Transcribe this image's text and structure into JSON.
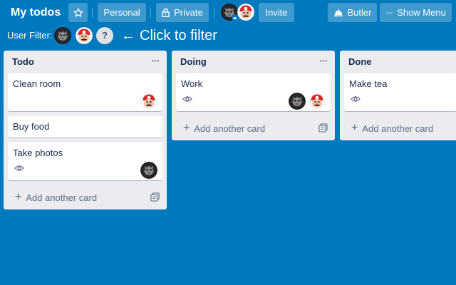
{
  "header": {
    "title": "My todos",
    "star_icon": "star-icon",
    "team_label": "Personal",
    "visibility_label": "Private",
    "visibility_icon": "lock-icon",
    "invite_label": "Invite",
    "butler_label": "Butler",
    "butler_icon": "butler-icon",
    "menu_label": "Show Menu",
    "menu_icon": "ellipsis-icon",
    "members": [
      "robot-avatar",
      "mario-avatar"
    ]
  },
  "filter": {
    "label": "User Filter:",
    "avatars": [
      "robot-avatar",
      "mario-avatar"
    ],
    "help_label": "?",
    "hint_arrow": "←",
    "hint_text": "Click to filter"
  },
  "lists": [
    {
      "title": "Todo",
      "menu_label": "···",
      "cards": [
        {
          "title": "Clean room",
          "watched": false,
          "members": [
            "mario-avatar"
          ]
        },
        {
          "title": "Buy food",
          "watched": false,
          "members": []
        },
        {
          "title": "Take photos",
          "watched": true,
          "members": [
            "robot-avatar"
          ]
        }
      ],
      "add_label": "Add another card"
    },
    {
      "title": "Doing",
      "menu_label": "···",
      "cards": [
        {
          "title": "Work",
          "watched": true,
          "members": [
            "robot-avatar",
            "mario-avatar"
          ]
        }
      ],
      "add_label": "Add another card"
    },
    {
      "title": "Done",
      "menu_label": "···",
      "cards": [
        {
          "title": "Make tea",
          "watched": true,
          "members": []
        }
      ],
      "add_label": "Add another card"
    }
  ],
  "colors": {
    "board_background": "#0079bf",
    "list_background": "#ebecf0",
    "card_background": "#ffffff",
    "mario_red": "#d62828",
    "robot_dark": "#1e1e1e"
  }
}
